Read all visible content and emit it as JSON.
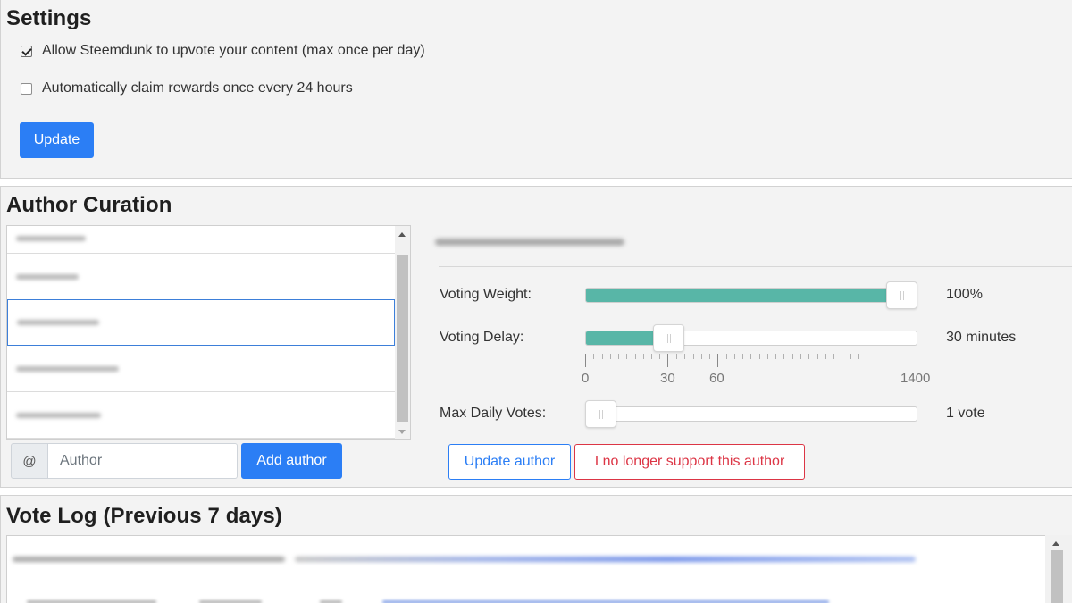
{
  "settings": {
    "title": "Settings",
    "options": [
      {
        "label": "Allow Steemdunk to upvote your content (max once per day)",
        "checked": true
      },
      {
        "label": "Automatically claim rewards once every 24 hours",
        "checked": false
      }
    ],
    "update_label": "Update"
  },
  "curation": {
    "title": "Author Curation",
    "author_input": {
      "prefix": "@",
      "placeholder": "Author"
    },
    "add_author_label": "Add author",
    "sliders": [
      {
        "label": "Voting Weight:",
        "value_text": "100%",
        "level": 1.0
      },
      {
        "label": "Voting Delay:",
        "value_text": "30 minutes",
        "level_minutes": 30,
        "max_minutes": 1400
      },
      {
        "label": "Max Daily Votes:",
        "value_text": "1 vote",
        "level": 0.0
      }
    ],
    "delay_ticks": [
      "0",
      "30",
      "60",
      "1400"
    ],
    "update_author_label": "Update author",
    "remove_author_label": "I no longer support this author"
  },
  "vote_log": {
    "title": "Vote Log (Previous 7 days)"
  },
  "colors": {
    "primary": "#2b7ef5",
    "danger": "#dc3545",
    "slider_fill": "#58b6a7",
    "panel_bg": "#f3f3f3"
  },
  "icons": {
    "checkbox_checked": "checkbox-checked-icon",
    "checkbox_unchecked": "checkbox-unchecked-icon",
    "scroll_up": "chevron-up-icon",
    "scroll_down": "chevron-down-icon"
  }
}
